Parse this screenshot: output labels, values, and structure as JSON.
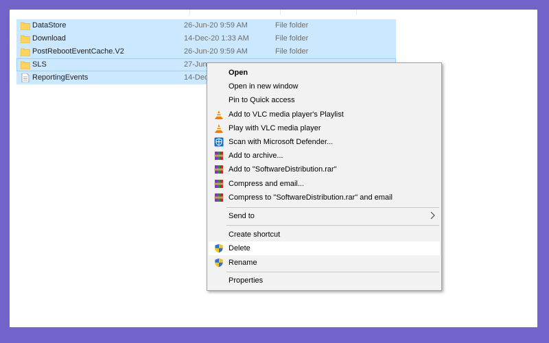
{
  "files": [
    {
      "name": "DataStore",
      "date": "26-Jun-20 9:59 AM",
      "type": "File folder",
      "kind": "folder"
    },
    {
      "name": "Download",
      "date": "14-Dec-20 1:33 AM",
      "type": "File folder",
      "kind": "folder"
    },
    {
      "name": "PostRebootEventCache.V2",
      "date": "26-Jun-20 9:59 AM",
      "type": "File folder",
      "kind": "folder"
    },
    {
      "name": "SLS",
      "date": "27-Jun",
      "type": "",
      "kind": "folder"
    },
    {
      "name": "ReportingEvents",
      "date": "14-Dec",
      "type": "",
      "kind": "file"
    }
  ],
  "menu": {
    "open": "Open",
    "open_new_window": "Open in new window",
    "pin_quick_access": "Pin to Quick access",
    "vlc_playlist": "Add to VLC media player's Playlist",
    "vlc_play": "Play with VLC media player",
    "defender_scan": "Scan with Microsoft Defender...",
    "add_archive": "Add to archive...",
    "add_rar": "Add to \"SoftwareDistribution.rar\"",
    "compress_email": "Compress and email...",
    "compress_rar_email": "Compress to \"SoftwareDistribution.rar\" and email",
    "send_to": "Send to",
    "create_shortcut": "Create shortcut",
    "delete": "Delete",
    "rename": "Rename",
    "properties": "Properties"
  },
  "icons": {
    "folder": "folder-icon",
    "file": "document-icon",
    "vlc": "vlc-cone-icon",
    "defender": "defender-shield-icon",
    "winrar": "winrar-books-icon",
    "uac": "uac-shield-icon"
  },
  "colors": {
    "background": "#7063c9",
    "selection": "#cce8ff",
    "menu_bg": "#f2f2f2",
    "folder": "#ffd45e"
  }
}
